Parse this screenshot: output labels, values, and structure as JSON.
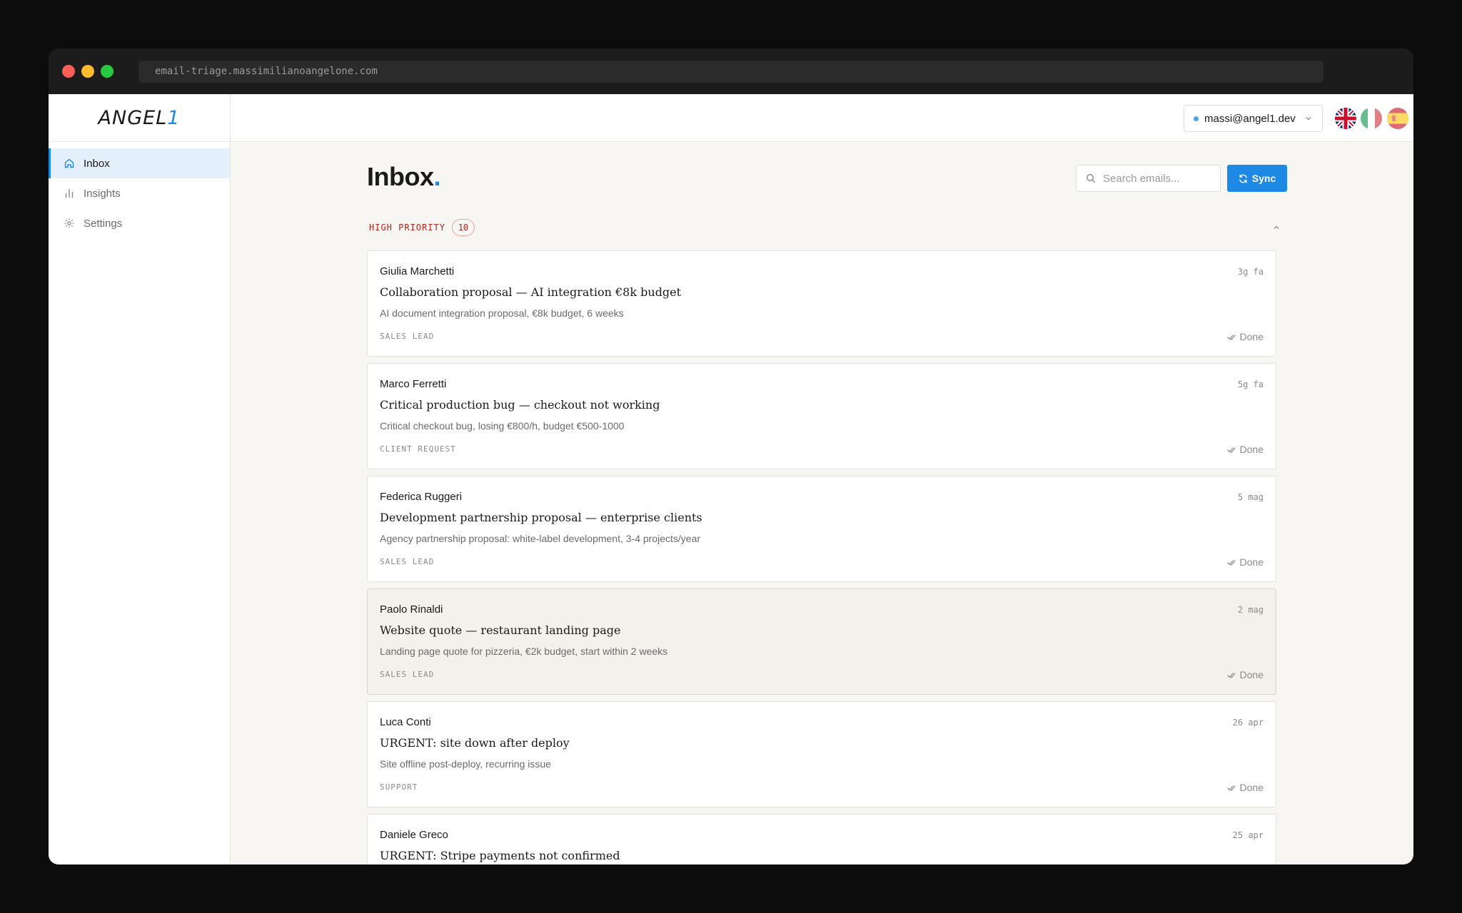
{
  "browser": {
    "url": "email-triage.massimilianoangelone.com"
  },
  "brand": {
    "name": "ANGEL",
    "accent": "1",
    "accent_color": "#1e88e5"
  },
  "sidebar": {
    "items": [
      {
        "label": "Inbox",
        "icon": "home-icon",
        "active": true
      },
      {
        "label": "Insights",
        "icon": "bar-chart-icon",
        "active": false
      },
      {
        "label": "Settings",
        "icon": "gear-icon",
        "active": false
      }
    ]
  },
  "topbar": {
    "account": "massi@angel1.dev",
    "languages": [
      "uk-flag-icon",
      "italy-flag-icon",
      "spain-flag-icon"
    ],
    "logout_icon": "logout-icon"
  },
  "main": {
    "title": "Inbox",
    "title_suffix": ".",
    "search_placeholder": "Search emails...",
    "sync_label": "Sync"
  },
  "group": {
    "title": "HIGH PRIORITY",
    "count": "10",
    "status_color": "#b3261e"
  },
  "emails": [
    {
      "sender": "Giulia Marchetti",
      "time": "3g fa",
      "subject": "Collaboration proposal — AI integration €8k budget",
      "summary": "AI document integration proposal, €8k budget, 6 weeks",
      "tag": "SALES LEAD",
      "action": "Done"
    },
    {
      "sender": "Marco Ferretti",
      "time": "5g fa",
      "subject": "Critical production bug — checkout not working",
      "summary": "Critical checkout bug, losing €800/h, budget €500-1000",
      "tag": "CLIENT REQUEST",
      "action": "Done"
    },
    {
      "sender": "Federica Ruggeri",
      "time": "5 mag",
      "subject": "Development partnership proposal — enterprise clients",
      "summary": "Agency partnership proposal: white-label development, 3-4 projects/year",
      "tag": "SALES LEAD",
      "action": "Done"
    },
    {
      "sender": "Paolo Rinaldi",
      "time": "2 mag",
      "subject": "Website quote — restaurant landing page",
      "summary": "Landing page quote for pizzeria, €2k budget, start within 2 weeks",
      "tag": "SALES LEAD",
      "action": "Done",
      "selected": true
    },
    {
      "sender": "Luca Conti",
      "time": "26 apr",
      "subject": "URGENT: site down after deploy",
      "summary": "Site offline post-deploy, recurring issue",
      "tag": "SUPPORT",
      "action": "Done"
    },
    {
      "sender": "Daniele Greco",
      "time": "25 apr",
      "subject": "URGENT: Stripe payments not confirmed",
      "summary": "",
      "tag": "",
      "action": ""
    }
  ]
}
